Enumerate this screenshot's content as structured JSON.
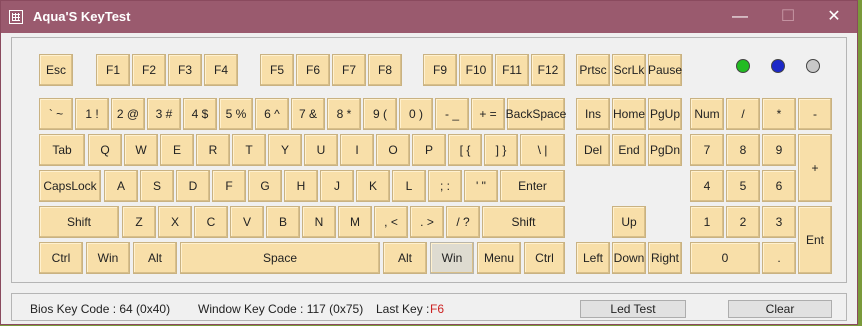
{
  "window": {
    "title": "Aqua'S KeyTest",
    "min_icon": "minimize-icon",
    "max_icon": "maximize-icon",
    "close_icon": "close-icon"
  },
  "leds": [
    {
      "name": "num-lock-led",
      "color": "#22bb22"
    },
    {
      "name": "caps-lock-led",
      "color": "#1c28c8"
    },
    {
      "name": "scroll-lock-led",
      "color": "#c8c8c8"
    }
  ],
  "keys": {
    "esc": "Esc",
    "f1": "F1",
    "f2": "F2",
    "f3": "F3",
    "f4": "F4",
    "f5": "F5",
    "f6": "F6",
    "f7": "F7",
    "f8": "F8",
    "f9": "F9",
    "f10": "F10",
    "f11": "F11",
    "f12": "F12",
    "prtsc": "Prtsc",
    "scrlk": "ScrLk",
    "pause": "Pause",
    "backtick": "` ~",
    "k1": "1 !",
    "k2": "2 @",
    "k3": "3 #",
    "k4": "4 $",
    "k5": "5 %",
    "k6": "6 ^",
    "k7": "7 &",
    "k8": "8 *",
    "k9": "9 (",
    "k0": "0 )",
    "minus": "- _",
    "equal": "+ =",
    "backspace": "BackSpace",
    "ins": "Ins",
    "home": "Home",
    "pgup": "PgUp",
    "num": "Num",
    "npdiv": "/",
    "npmul": "*",
    "npsub": "-",
    "tab": "Tab",
    "q": "Q",
    "w": "W",
    "e": "E",
    "r": "R",
    "t": "T",
    "y": "Y",
    "u": "U",
    "i": "I",
    "o": "O",
    "p": "P",
    "lbracket": "[ {",
    "rbracket": "] }",
    "backslash": "\\ |",
    "del": "Del",
    "end": "End",
    "pgdn": "PgDn",
    "np7": "7",
    "np8": "8",
    "np9": "9",
    "npadd": "+",
    "capslock": "CapsLock",
    "a": "A",
    "s": "S",
    "d": "D",
    "f": "F",
    "g": "G",
    "h": "H",
    "j": "J",
    "k": "K",
    "l": "L",
    "semicolon": "; :",
    "quote": "' \"",
    "enter": "Enter",
    "np4": "4",
    "np5": "5",
    "np6": "6",
    "lshift": "Shift",
    "z": "Z",
    "x": "X",
    "c": "C",
    "v": "V",
    "b": "B",
    "n": "N",
    "m": "M",
    "comma": ", <",
    "period": ". >",
    "slash": "/ ?",
    "rshift": "Shift",
    "up": "Up",
    "np1": "1",
    "np2": "2",
    "np3": "3",
    "npenter": "Ent",
    "lctrl": "Ctrl",
    "lwin": "Win",
    "lalt": "Alt",
    "space": "Space",
    "ralt": "Alt",
    "rwin": "Win",
    "menu": "Menu",
    "rctrl": "Ctrl",
    "left": "Left",
    "down": "Down",
    "right": "Right",
    "np0": "0",
    "npdot": "."
  },
  "status": {
    "bios_label": "Bios Key Code : 64 (0x40)",
    "window_label": "Window Key Code : 117 (0x75)",
    "last_key_label": "Last Key :",
    "last_key_value": "F6",
    "led_test_button": "Led Test",
    "clear_button": "Clear"
  }
}
